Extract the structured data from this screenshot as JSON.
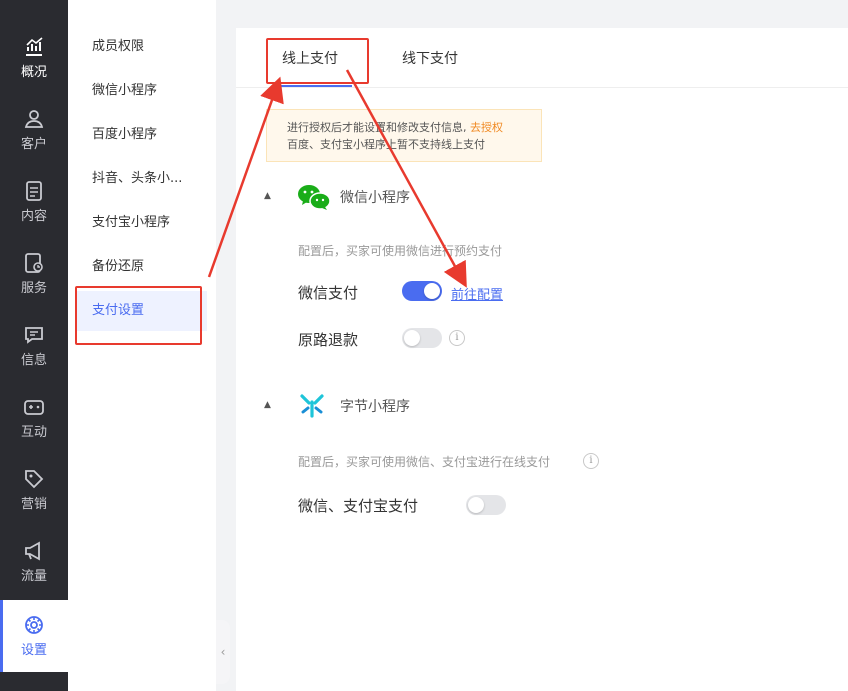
{
  "left_nav": [
    {
      "label": "概况",
      "icon": "trend-chart-icon"
    },
    {
      "label": "客户",
      "icon": "user-icon"
    },
    {
      "label": "内容",
      "icon": "document-icon"
    },
    {
      "label": "服务",
      "icon": "service-icon"
    },
    {
      "label": "信息",
      "icon": "message-icon"
    },
    {
      "label": "互动",
      "icon": "gamepad-icon"
    },
    {
      "label": "营销",
      "icon": "tag-icon"
    },
    {
      "label": "流量",
      "icon": "megaphone-icon"
    },
    {
      "label": "设置",
      "icon": "settings-icon"
    }
  ],
  "submenu": {
    "items": [
      "成员权限",
      "微信小程序",
      "百度小程序",
      "抖音、头条小...",
      "支付宝小程序",
      "备份还原",
      "支付设置"
    ],
    "selected": "支付设置"
  },
  "tabs": {
    "online": "线上支付",
    "offline": "线下支付",
    "active": "线上支付"
  },
  "notice": {
    "line1": "进行授权后才能设置和修改支付信息,",
    "link": "去授权",
    "line2": "百度、支付宝小程序上暂不支持线上支付"
  },
  "wechat_section": {
    "title": "微信小程序",
    "desc": "配置后，买家可使用微信进行预约支付",
    "pay_label": "微信支付",
    "pay_enabled": true,
    "config_link": "前往配置",
    "refund_label": "原路退款",
    "refund_enabled": false,
    "info": "i"
  },
  "bytedance_section": {
    "title": "字节小程序",
    "desc": "配置后，买家可使用微信、支付宝进行在线支付",
    "pay_label": "微信、支付宝支付",
    "pay_enabled": false,
    "info": "i"
  },
  "colors": {
    "accent": "#4a6cf0",
    "nav_bg": "#2a2b30",
    "annotation_red": "#e83a2e",
    "notice_link": "#f08a24",
    "wechat_green": "#1aad19",
    "bytedance_cyan": "#1ec5d9"
  }
}
